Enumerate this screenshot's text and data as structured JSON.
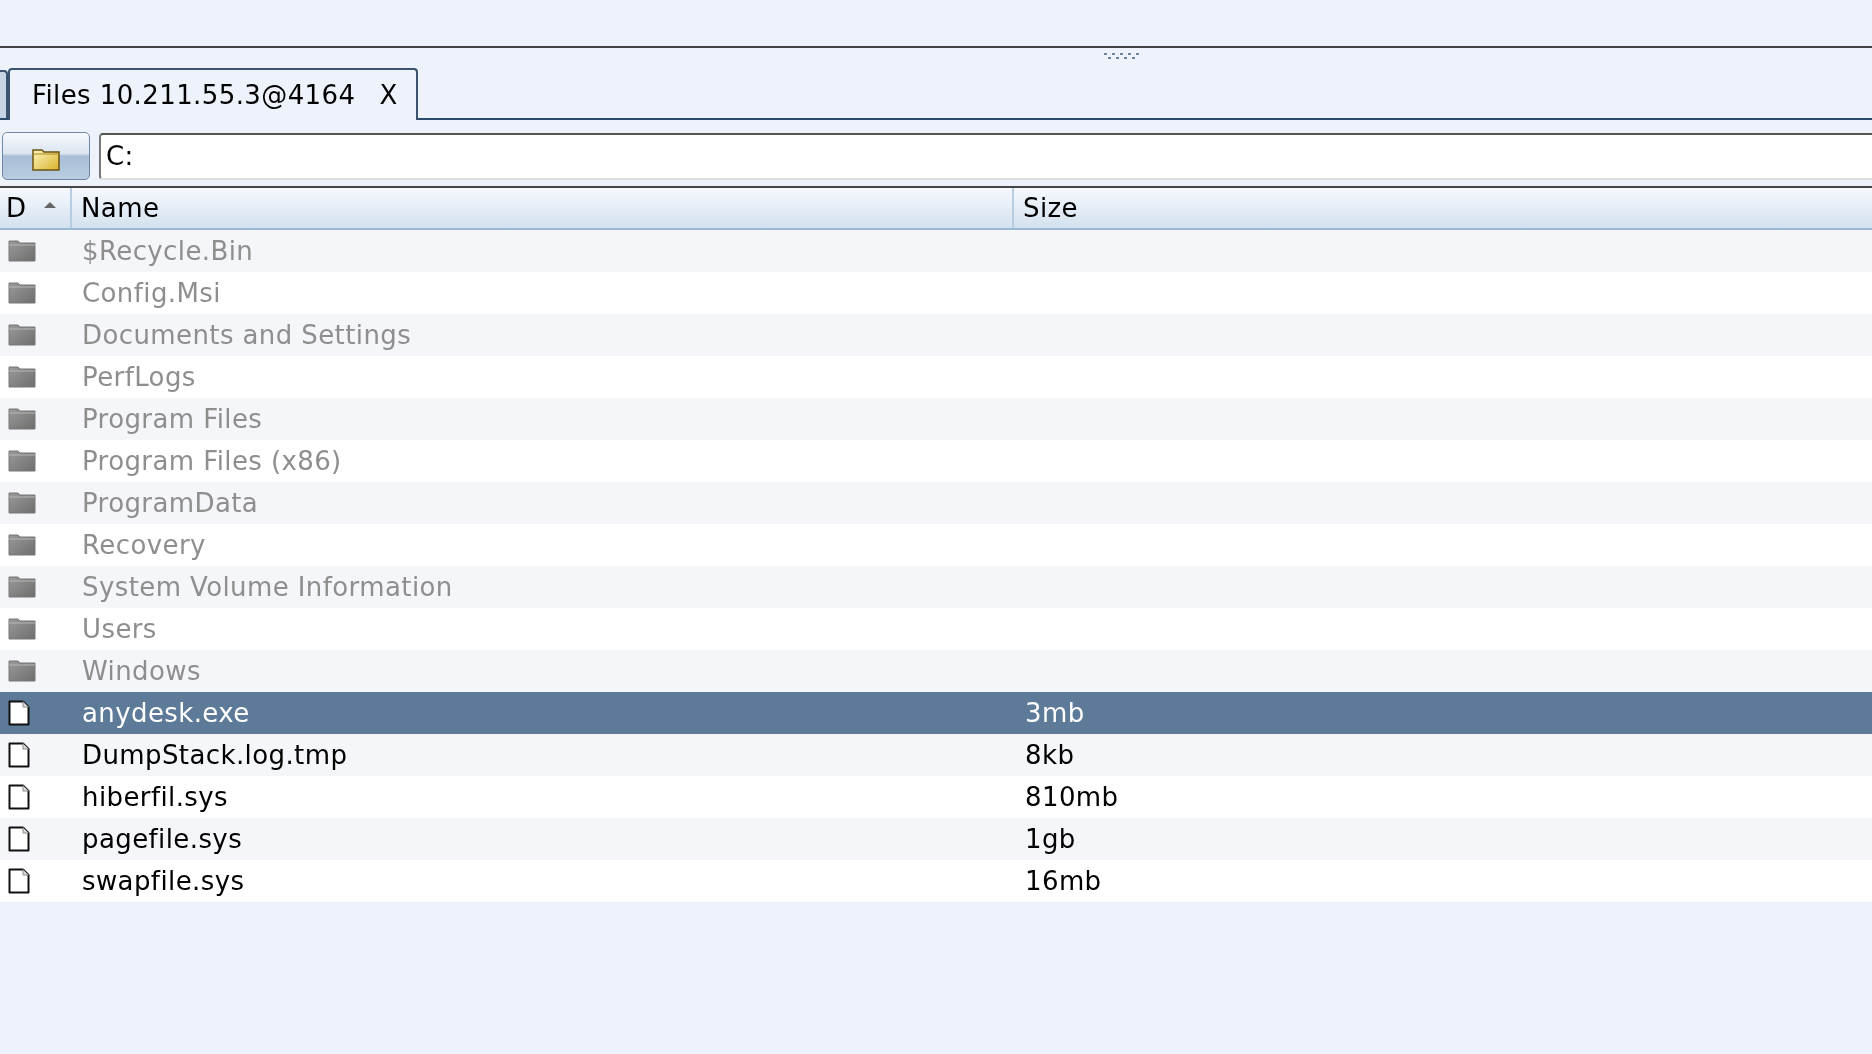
{
  "tabs": [
    {
      "selected": false
    },
    {
      "label": "Files 10.211.55.3@4164",
      "close": "X",
      "selected": true
    }
  ],
  "path_field": {
    "value": "C:"
  },
  "table": {
    "columns": [
      {
        "label": "D",
        "sorted": true
      },
      {
        "label": "Name",
        "sorted": false
      },
      {
        "label": "Size",
        "sorted": false
      }
    ],
    "rows": [
      {
        "kind": "folder",
        "name": "$Recycle.Bin",
        "selected": false
      },
      {
        "kind": "folder",
        "name": "Config.Msi",
        "selected": false
      },
      {
        "kind": "folder",
        "name": "Documents and Settings",
        "selected": false
      },
      {
        "kind": "folder",
        "name": "PerfLogs",
        "selected": false
      },
      {
        "kind": "folder",
        "name": "Program Files",
        "selected": false
      },
      {
        "kind": "folder",
        "name": "Program Files (x86)",
        "selected": false
      },
      {
        "kind": "folder",
        "name": "ProgramData",
        "selected": false
      },
      {
        "kind": "folder",
        "name": "Recovery",
        "selected": false
      },
      {
        "kind": "folder",
        "name": "System Volume Information",
        "selected": false
      },
      {
        "kind": "folder",
        "name": "Users",
        "selected": false
      },
      {
        "kind": "folder",
        "name": "Windows",
        "selected": false
      },
      {
        "kind": "file",
        "name": "anydesk.exe",
        "size": "3mb",
        "selected": true
      },
      {
        "kind": "file",
        "name": "DumpStack.log.tmp",
        "size": "8kb",
        "selected": false
      },
      {
        "kind": "file",
        "name": "hiberfil.sys",
        "size": "810mb",
        "selected": false
      },
      {
        "kind": "file",
        "name": "pagefile.sys",
        "size": "1gb",
        "selected": false
      },
      {
        "kind": "file",
        "name": "swapfile.sys",
        "size": "16mb",
        "selected": false
      }
    ]
  }
}
